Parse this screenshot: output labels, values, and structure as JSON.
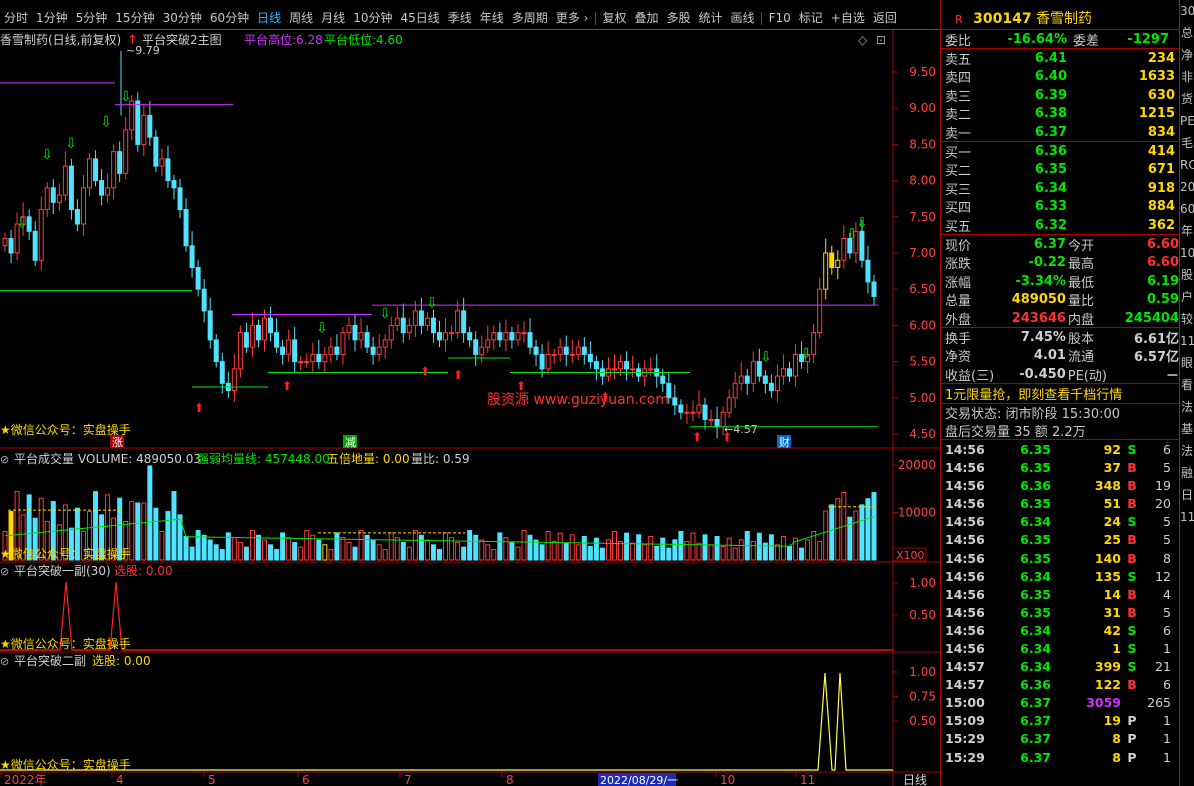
{
  "toolbar": [
    "分时",
    "1分钟",
    "5分钟",
    "15分钟",
    "30分钟",
    "60分钟",
    "日线",
    "周线",
    "月线",
    "10分钟",
    "45日线",
    "季线",
    "年线",
    "多周期",
    "更多 ›",
    "复权",
    "叠加",
    "多股",
    "统计",
    "画线",
    "F10",
    "标记",
    "+自选",
    "返回"
  ],
  "toolbar_active": 6,
  "main_title": {
    "name": "香雪制药(日线,前复权)",
    "indicator": "平台突破2主图",
    "high_label": "平台高位:",
    "high_value": "6.28",
    "low_label": "平台低位:",
    "low_value": "4.60"
  },
  "watermark": "股资源 www.guziyuan.com",
  "wechat": "★微信公众号：实盘操手",
  "main_axis": [
    "9.50",
    "9.00",
    "8.50",
    "8.00",
    "7.50",
    "7.00",
    "6.50",
    "6.00",
    "5.50",
    "5.00",
    "4.50"
  ],
  "annotations": {
    "high": "9.79",
    "low": "4.57",
    "tags": [
      "涨",
      "减",
      "财"
    ]
  },
  "vol_title": {
    "name": "平台成交量",
    "v1": "VOLUME: 489050.03",
    "v2": "强弱均量线: 457448.00",
    "v3": "五倍地量: 0.00",
    "v4": "量比: 0.59"
  },
  "vol_axis": [
    "20000",
    "10000"
  ],
  "vol_unit": "X100",
  "sub1_title": {
    "name": "平台突破一副(30)",
    "sel": "选股: 0.00"
  },
  "sub1_axis": [
    "1.00",
    "0.50"
  ],
  "sub2_title": {
    "name": "平台突破二副",
    "sel": "选股: 0.00"
  },
  "sub2_axis": [
    "1.00",
    "0.75",
    "0.50"
  ],
  "date_axis": [
    "2022年",
    "4",
    "5",
    "6",
    "7",
    "8",
    "2022/08/29/一",
    "10",
    "11"
  ],
  "period_label": "日线",
  "stock": {
    "marker": "R",
    "code": "300147",
    "name": "香雪制药"
  },
  "weibi": {
    "lab": "委比",
    "val": "-16.64%",
    "lab2": "委差",
    "val2": "-1297"
  },
  "sell": [
    {
      "lab": "卖五",
      "price": "6.41",
      "vol": "234"
    },
    {
      "lab": "卖四",
      "price": "6.40",
      "vol": "1633"
    },
    {
      "lab": "卖三",
      "price": "6.39",
      "vol": "630"
    },
    {
      "lab": "卖二",
      "price": "6.38",
      "vol": "1215"
    },
    {
      "lab": "卖一",
      "price": "6.37",
      "vol": "834"
    }
  ],
  "buy": [
    {
      "lab": "买一",
      "price": "6.36",
      "vol": "414"
    },
    {
      "lab": "买二",
      "price": "6.35",
      "vol": "671"
    },
    {
      "lab": "买三",
      "price": "6.34",
      "vol": "918"
    },
    {
      "lab": "买四",
      "price": "6.33",
      "vol": "884"
    },
    {
      "lab": "买五",
      "price": "6.32",
      "vol": "362"
    }
  ],
  "quote": [
    {
      "l1": "现价",
      "v1": "6.37",
      "c1": "g",
      "l2": "今开",
      "v2": "6.60",
      "c2": "r"
    },
    {
      "l1": "涨跌",
      "v1": "-0.22",
      "c1": "g",
      "l2": "最高",
      "v2": "6.60",
      "c2": "r"
    },
    {
      "l1": "涨幅",
      "v1": "-3.34%",
      "c1": "g",
      "l2": "最低",
      "v2": "6.19",
      "c2": "g"
    },
    {
      "l1": "总量",
      "v1": "489050",
      "c1": "y",
      "l2": "量比",
      "v2": "0.59",
      "c2": "g"
    },
    {
      "l1": "外盘",
      "v1": "243646",
      "c1": "r",
      "l2": "内盘",
      "v2": "245404",
      "c2": "g"
    }
  ],
  "stats": [
    {
      "l1": "换手",
      "v1": "7.45%",
      "l2": "股本",
      "v2": "6.61亿"
    },
    {
      "l1": "净资",
      "v1": "4.01",
      "l2": "流通",
      "v2": "6.57亿"
    },
    {
      "l1": "收益(三)",
      "v1": "-0.450",
      "l2": "PE(动)",
      "v2": "－"
    }
  ],
  "ad": "1元限量抢，即刻查看千档行情",
  "status": "交易状态: 闭市阶段 15:30:00",
  "after": "盘后交易量 35 额 2.2万",
  "ticks": [
    {
      "t": "14:56",
      "p": "6.35",
      "v": "92",
      "s": "S",
      "c": "6"
    },
    {
      "t": "14:56",
      "p": "6.35",
      "v": "37",
      "s": "B",
      "c": "5"
    },
    {
      "t": "14:56",
      "p": "6.36",
      "v": "348",
      "s": "B",
      "c": "19"
    },
    {
      "t": "14:56",
      "p": "6.35",
      "v": "51",
      "s": "B",
      "c": "20"
    },
    {
      "t": "14:56",
      "p": "6.34",
      "v": "24",
      "s": "S",
      "c": "5"
    },
    {
      "t": "14:56",
      "p": "6.35",
      "v": "25",
      "s": "B",
      "c": "5"
    },
    {
      "t": "14:56",
      "p": "6.35",
      "v": "140",
      "s": "B",
      "c": "8"
    },
    {
      "t": "14:56",
      "p": "6.34",
      "v": "135",
      "s": "S",
      "c": "12"
    },
    {
      "t": "14:56",
      "p": "6.35",
      "v": "14",
      "s": "B",
      "c": "4"
    },
    {
      "t": "14:56",
      "p": "6.35",
      "v": "31",
      "s": "B",
      "c": "5"
    },
    {
      "t": "14:56",
      "p": "6.34",
      "v": "42",
      "s": "S",
      "c": "6"
    },
    {
      "t": "14:56",
      "p": "6.34",
      "v": "1",
      "s": "S",
      "c": "1"
    },
    {
      "t": "14:57",
      "p": "6.34",
      "v": "399",
      "s": "S",
      "c": "21"
    },
    {
      "t": "14:57",
      "p": "6.36",
      "v": "122",
      "s": "B",
      "c": "6"
    },
    {
      "t": "15:00",
      "p": "6.37",
      "v": "3059",
      "s": "",
      "c": "265"
    },
    {
      "t": "15:09",
      "p": "6.37",
      "v": "19",
      "s": "P",
      "c": "1"
    },
    {
      "t": "15:29",
      "p": "6.37",
      "v": "8",
      "s": "P",
      "c": "1"
    },
    {
      "t": "15:29",
      "p": "6.37",
      "v": "8",
      "s": "P",
      "c": "1"
    }
  ],
  "edge": [
    "30",
    "总",
    "净",
    "非",
    "货",
    "PE",
    "毛",
    "RO",
    "20",
    "60",
    "年",
    "10",
    "股",
    "户",
    "较",
    "11",
    "眼",
    "看",
    "法",
    "基",
    "法",
    "融",
    "日",
    "11"
  ]
}
